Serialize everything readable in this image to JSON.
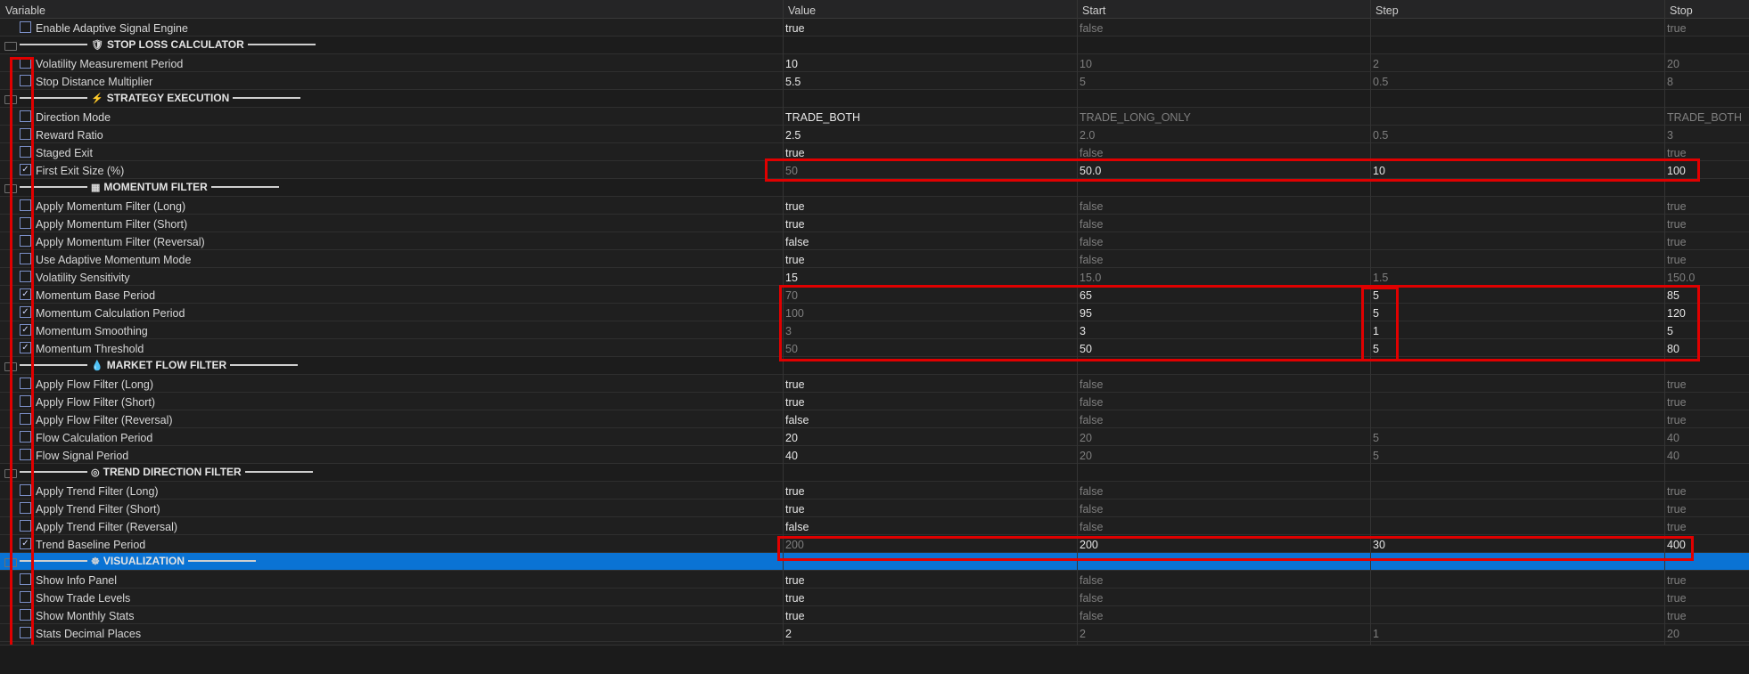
{
  "columns": {
    "variable": "Variable",
    "value": "Value",
    "start": "Start",
    "step": "Step",
    "stop": "Stop"
  },
  "rows": [
    {
      "type": "param",
      "label": "Enable Adaptive Signal Engine",
      "checked": false,
      "value": "true",
      "start": "false",
      "step": "",
      "stop": "true",
      "v_dim": false
    },
    {
      "type": "section",
      "label": "STOP LOSS CALCULATOR",
      "icon": "shield-icon",
      "glyph": "🛡"
    },
    {
      "type": "param",
      "label": "Volatility Measurement Period",
      "checked": false,
      "value": "10",
      "start": "10",
      "step": "2",
      "stop": "20",
      "v_dim": false
    },
    {
      "type": "param",
      "label": "Stop Distance Multiplier",
      "checked": false,
      "value": "5.5",
      "start": "5",
      "step": "0.5",
      "stop": "8",
      "v_dim": false
    },
    {
      "type": "section",
      "label": "STRATEGY EXECUTION",
      "icon": "lightning-icon",
      "glyph": "⚡"
    },
    {
      "type": "param",
      "label": "Direction Mode",
      "checked": false,
      "value": "TRADE_BOTH",
      "start": "TRADE_LONG_ONLY",
      "step": "",
      "stop": "TRADE_BOTH",
      "v_dim": false
    },
    {
      "type": "param",
      "label": "Reward Ratio",
      "checked": false,
      "value": "2.5",
      "start": "2.0",
      "step": "0.5",
      "stop": "3",
      "v_dim": false
    },
    {
      "type": "param",
      "label": "Staged Exit",
      "checked": false,
      "value": "true",
      "start": "false",
      "step": "",
      "stop": "true",
      "v_dim": false
    },
    {
      "type": "param",
      "label": "First Exit Size (%)",
      "checked": true,
      "value": "50",
      "start": "50.0",
      "step": "10",
      "stop": "100",
      "v_dim": true
    },
    {
      "type": "section",
      "label": "MOMENTUM FILTER",
      "icon": "calculator-icon",
      "glyph": "▦"
    },
    {
      "type": "param",
      "label": "Apply Momentum Filter (Long)",
      "checked": false,
      "value": "true",
      "start": "false",
      "step": "",
      "stop": "true",
      "v_dim": false
    },
    {
      "type": "param",
      "label": "Apply Momentum Filter (Short)",
      "checked": false,
      "value": "true",
      "start": "false",
      "step": "",
      "stop": "true",
      "v_dim": false
    },
    {
      "type": "param",
      "label": "Apply Momentum Filter (Reversal)",
      "checked": false,
      "value": "false",
      "start": "false",
      "step": "",
      "stop": "true",
      "v_dim": false
    },
    {
      "type": "param",
      "label": "Use Adaptive Momentum Mode",
      "checked": false,
      "value": "true",
      "start": "false",
      "step": "",
      "stop": "true",
      "v_dim": false
    },
    {
      "type": "param",
      "label": "Volatility Sensitivity",
      "checked": false,
      "value": "15",
      "start": "15.0",
      "step": "1.5",
      "stop": "150.0",
      "v_dim": false
    },
    {
      "type": "param",
      "label": "Momentum Base Period",
      "checked": true,
      "value": "70",
      "start": "65",
      "step": "5",
      "stop": "85",
      "v_dim": true
    },
    {
      "type": "param",
      "label": "Momentum Calculation Period",
      "checked": true,
      "value": "100",
      "start": "95",
      "step": "5",
      "stop": "120",
      "v_dim": true
    },
    {
      "type": "param",
      "label": "Momentum Smoothing",
      "checked": true,
      "value": "3",
      "start": "3",
      "step": "1",
      "stop": "5",
      "v_dim": true
    },
    {
      "type": "param",
      "label": "Momentum Threshold",
      "checked": true,
      "value": "50",
      "start": "50",
      "step": "5",
      "stop": "80",
      "v_dim": true
    },
    {
      "type": "section",
      "label": "MARKET FLOW FILTER",
      "icon": "droplet-icon",
      "glyph": "💧"
    },
    {
      "type": "param",
      "label": "Apply Flow Filter (Long)",
      "checked": false,
      "value": "true",
      "start": "false",
      "step": "",
      "stop": "true",
      "v_dim": false
    },
    {
      "type": "param",
      "label": "Apply Flow Filter (Short)",
      "checked": false,
      "value": "true",
      "start": "false",
      "step": "",
      "stop": "true",
      "v_dim": false
    },
    {
      "type": "param",
      "label": "Apply Flow Filter (Reversal)",
      "checked": false,
      "value": "false",
      "start": "false",
      "step": "",
      "stop": "true",
      "v_dim": false
    },
    {
      "type": "param",
      "label": "Flow Calculation Period",
      "checked": false,
      "value": "20",
      "start": "20",
      "step": "5",
      "stop": "40",
      "v_dim": false
    },
    {
      "type": "param",
      "label": "Flow Signal Period",
      "checked": false,
      "value": "40",
      "start": "20",
      "step": "5",
      "stop": "40",
      "v_dim": false
    },
    {
      "type": "section",
      "label": "TREND DIRECTION FILTER",
      "icon": "compass-icon",
      "glyph": "◎"
    },
    {
      "type": "param",
      "label": "Apply Trend Filter (Long)",
      "checked": false,
      "value": "true",
      "start": "false",
      "step": "",
      "stop": "true",
      "v_dim": false
    },
    {
      "type": "param",
      "label": "Apply Trend Filter (Short)",
      "checked": false,
      "value": "true",
      "start": "false",
      "step": "",
      "stop": "true",
      "v_dim": false
    },
    {
      "type": "param",
      "label": "Apply Trend Filter (Reversal)",
      "checked": false,
      "value": "false",
      "start": "false",
      "step": "",
      "stop": "true",
      "v_dim": false
    },
    {
      "type": "param",
      "label": "Trend Baseline Period",
      "checked": true,
      "value": "200",
      "start": "200",
      "step": "30",
      "stop": "400",
      "v_dim": true
    },
    {
      "type": "section",
      "label": "VISUALIZATION",
      "icon": "palette-icon",
      "glyph": "☸",
      "selected": true
    },
    {
      "type": "param",
      "label": "Show Info Panel",
      "checked": false,
      "value": "true",
      "start": "false",
      "step": "",
      "stop": "true",
      "v_dim": false
    },
    {
      "type": "param",
      "label": "Show Trade Levels",
      "checked": false,
      "value": "true",
      "start": "false",
      "step": "",
      "stop": "true",
      "v_dim": false
    },
    {
      "type": "param",
      "label": "Show Monthly Stats",
      "checked": false,
      "value": "true",
      "start": "false",
      "step": "",
      "stop": "true",
      "v_dim": false
    },
    {
      "type": "param",
      "label": "Stats Decimal Places",
      "checked": false,
      "value": "2",
      "start": "2",
      "step": "1",
      "stop": "20",
      "v_dim": false
    }
  ],
  "highlight_color": "#e00000"
}
